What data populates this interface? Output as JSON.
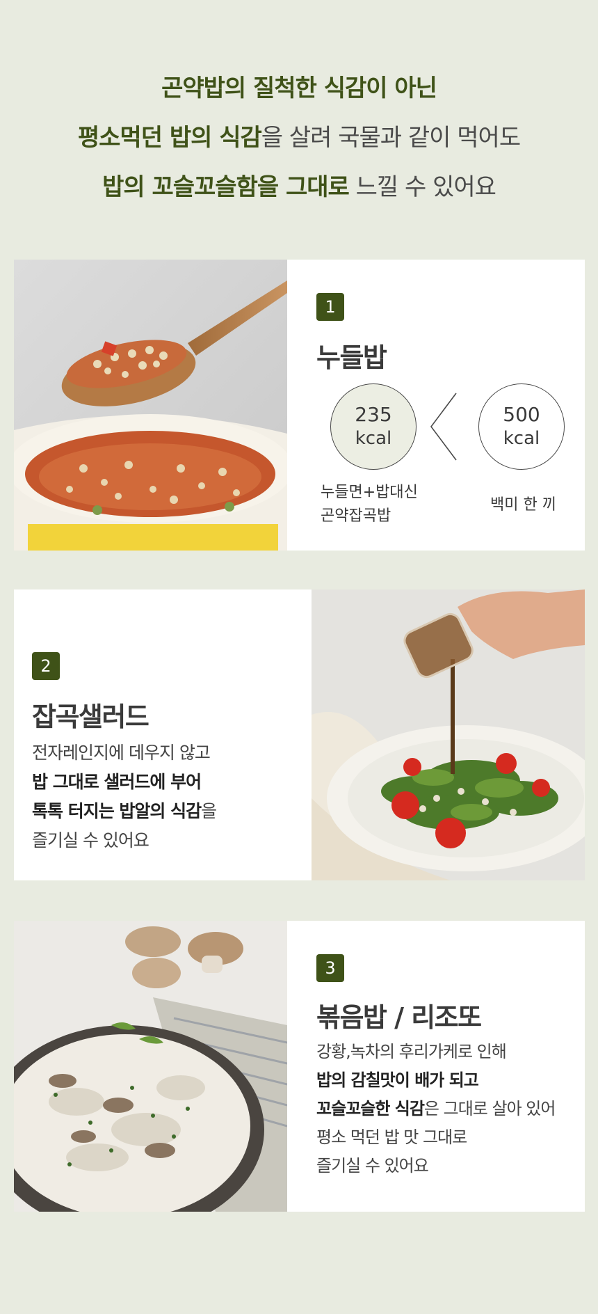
{
  "headline": {
    "line1": "곤약밥의 질척한 식감이 아닌",
    "line2_bold": "평소먹던 밥의 식감",
    "line2_rest": "을 살려 국물과 같이 먹어도",
    "line3_bold": "밥의 꼬슬꼬슬함을 그대로",
    "line3_rest": " 느낄 수 있어요"
  },
  "cards": [
    {
      "number": "1",
      "title": "누들밥",
      "compare": {
        "left": {
          "value": "235",
          "unit": "kcal",
          "caption1": "누들면+밥대신",
          "caption2": "곤약잡곡밥"
        },
        "right": {
          "value": "500",
          "unit": "kcal",
          "caption": "백미 한 끼"
        },
        "symbol": "<"
      }
    },
    {
      "number": "2",
      "title": "잡곡샐러드",
      "lines": [
        {
          "plain": "전자레인지에 데우지 않고"
        },
        {
          "bold": "밥 그대로 샐러드에 부어"
        },
        {
          "bold": "톡톡 터지는 밥알의 식감",
          "plain": "을"
        },
        {
          "plain": "즐기실 수 있어요"
        }
      ]
    },
    {
      "number": "3",
      "title": "볶음밥 / 리조또",
      "lines": [
        {
          "plain": "강황,녹차의 후리가케로 인해"
        },
        {
          "bold": "밥의 감칠맛이 배가 되고"
        },
        {
          "bold": "꼬슬꼬슬한 식감",
          "plain": "은 그대로 살아 있어"
        },
        {
          "plain": "평소 먹던 밥 맛 그대로"
        },
        {
          "plain": "즐기실 수 있어요"
        }
      ]
    }
  ],
  "colors": {
    "accent": "#3f5218",
    "background": "#e8ebe0",
    "card": "#ffffff"
  }
}
